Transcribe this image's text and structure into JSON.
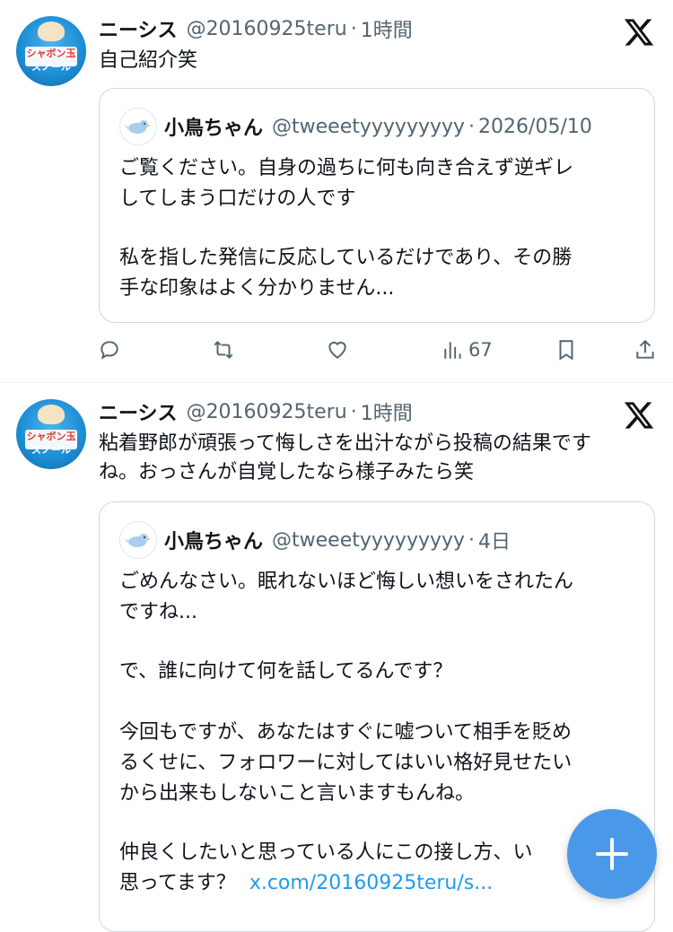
{
  "tweets": [
    {
      "author_name": "ニーシス",
      "author_handle": "@20160925teru",
      "sep": "·",
      "time": "1時間",
      "text": "自己紹介笑",
      "quoted": {
        "author_name": "小鳥ちゃん",
        "author_handle": "@tweeetyyyyyyyyy",
        "sep": "·",
        "date": "2026/05/10",
        "paragraphs": [
          "ご覧ください。自身の過ちに何も向き合えず逆ギレ\nしてしまう口だけの人です",
          "私を指した発信に反応しているだけであり、その勝\n手な印象はよく分かりません..."
        ]
      },
      "views": "67"
    },
    {
      "author_name": "ニーシス",
      "author_handle": "@20160925teru",
      "sep": "·",
      "time": "1時間",
      "text": "粘着野郎が頑張って悔しさを出汁ながら投稿の結果です\nね。おっさんが自覚したなら様子みたら笑",
      "quoted": {
        "author_name": "小鳥ちゃん",
        "author_handle": "@tweeetyyyyyyyyy",
        "sep": "·",
        "date": "4日",
        "paragraphs": [
          "ごめんなさい。眠れないほど悔しい想いをされたん\nですね...",
          "で、誰に向けて何を話してるんです？",
          "今回もですが、あなたはすぐに嘘ついて相手を貶め\nるくせに、フォロワーに対してはいい格好見せたい\nから出来もしないこと言いますもんね。",
          "仲良くしたいと思っている人にこの接し方、い"
        ],
        "last_line": "思ってます？",
        "link": "x.com/20160925teru/s..."
      }
    }
  ],
  "avatar_text": [
    "シャボン玉",
    "スノール"
  ],
  "colors": {
    "accent": "#1d9bf0",
    "fab": "#4a99e9",
    "muted": "#536471"
  },
  "icons": [
    "x-logo-icon",
    "reply-icon",
    "retweet-icon",
    "like-icon",
    "views-icon",
    "bookmark-icon",
    "share-icon",
    "plus-icon"
  ]
}
